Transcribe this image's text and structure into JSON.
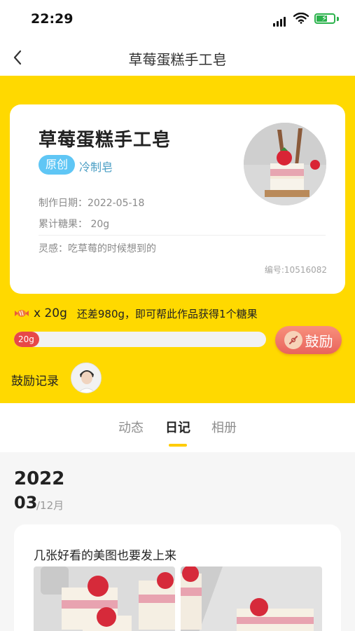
{
  "status_bar": {
    "time": "22:29"
  },
  "nav": {
    "title": "草莓蛋糕手工皂"
  },
  "product": {
    "name": "草莓蛋糕手工皂",
    "tag_original": "原创",
    "tag_type": "冷制皂",
    "made_date": "制作日期：2022-05-18",
    "total_sugar": "累计糖果：  20g",
    "inspiration": "灵感：吃草莓的时候想到的",
    "serial": "编号:10516082"
  },
  "sugar": {
    "amount": "x 20g",
    "hint": "还差980g，即可帮此作品获得1个糖果",
    "progress_label": "20g",
    "progress_fraction": 0.02
  },
  "encourage_button": "鼓励",
  "records_label": "鼓励记录",
  "tabs": [
    "动态",
    "日记",
    "相册"
  ],
  "active_tab": "日记",
  "diary": {
    "year": "2022",
    "month": "03",
    "month_rest": "/12月",
    "entry_text": "几张好看的美图也要发上来"
  },
  "colors": {
    "brand_yellow": "#ffd900",
    "tab_indicator": "#ffcc00",
    "progress_red": "#e74848",
    "tag_blue": "#5fc6f5"
  },
  "icons": [
    "back-chevron-icon",
    "signal-icon",
    "wifi-icon",
    "battery-icon",
    "candy-icon",
    "encourage-icon"
  ]
}
